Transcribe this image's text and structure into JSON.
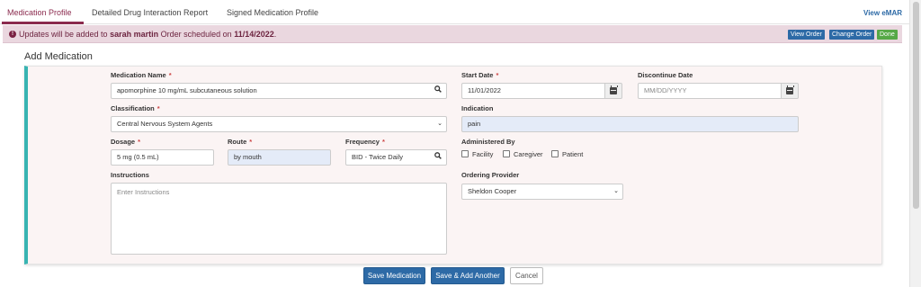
{
  "tabs": {
    "medication_profile": "Medication Profile",
    "drug_interaction": "Detailed Drug Interaction Report",
    "signed_profile": "Signed Medication Profile",
    "view_emar": "View eMAR"
  },
  "banner": {
    "prefix": "Updates will be added to",
    "patient_name": "sarah martin",
    "middle": "Order scheduled on",
    "date": "11/14/2022",
    "suffix": ".",
    "view_order": "View Order",
    "change_order": "Change Order",
    "done": "Done"
  },
  "section_title": "Add Medication",
  "form": {
    "required_mark": "*",
    "medication_name": {
      "label": "Medication Name",
      "value": "apomorphine 10 mg/mL subcutaneous solution"
    },
    "start_date": {
      "label": "Start Date",
      "value": "11/01/2022"
    },
    "discontinue_date": {
      "label": "Discontinue Date",
      "placeholder": "MM/DD/YYYY"
    },
    "classification": {
      "label": "Classification",
      "value": "Central Nervous System Agents"
    },
    "indication": {
      "label": "Indication",
      "value": "pain"
    },
    "dosage": {
      "label": "Dosage",
      "value": "5 mg (0.5 mL)"
    },
    "route": {
      "label": "Route",
      "value": "by mouth"
    },
    "frequency": {
      "label": "Frequency",
      "value": "BID - Twice Daily"
    },
    "administered_by": {
      "label": "Administered By",
      "options": [
        "Facility",
        "Caregiver",
        "Patient"
      ]
    },
    "instructions": {
      "label": "Instructions",
      "placeholder": "Enter Instructions"
    },
    "ordering_provider": {
      "label": "Ordering Provider",
      "value": "Sheldon Cooper"
    }
  },
  "buttons": {
    "save": "Save Medication",
    "save_add": "Save & Add Another",
    "cancel": "Cancel"
  },
  "colors": {
    "brand": "#8b2b4e",
    "primary_button": "#2d6aa6",
    "done_button": "#56a846",
    "card_accent": "#38b4b2",
    "banner_bg": "#ead7df",
    "highlight_field": "#e4ebf8"
  },
  "icons": {
    "search": "search-icon",
    "calendar": "calendar-icon",
    "dropdown": "chevron-down-icon",
    "info": "info-icon"
  }
}
